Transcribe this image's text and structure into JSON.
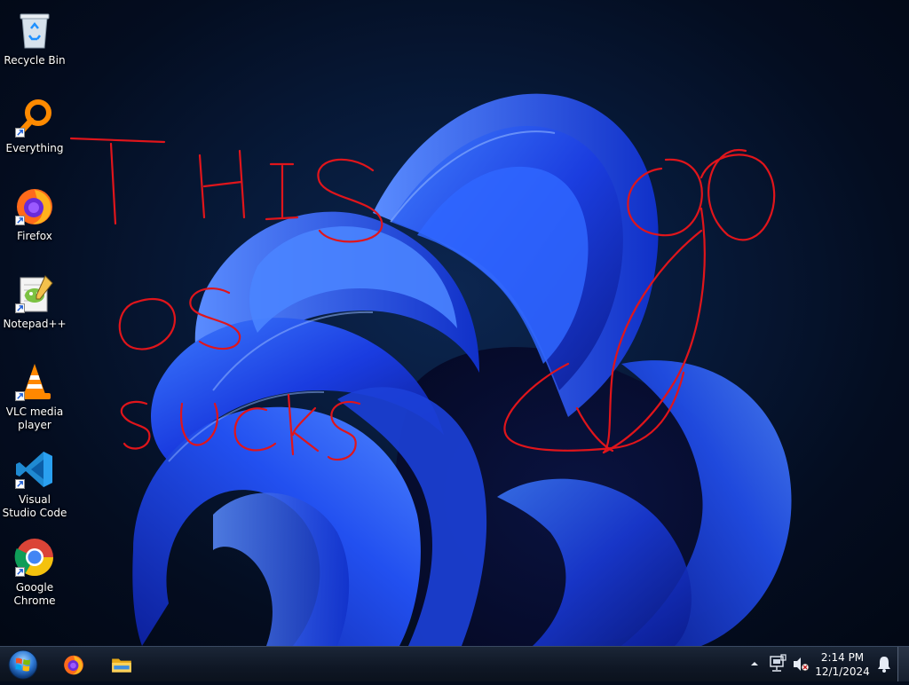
{
  "desktop": {
    "icons": [
      {
        "label": "Recycle Bin",
        "icon": "recycle-bin-icon",
        "shortcut": false
      },
      {
        "label": "Everything",
        "icon": "everything-search-icon",
        "shortcut": true
      },
      {
        "label": "Firefox",
        "icon": "firefox-icon",
        "shortcut": true
      },
      {
        "label": "Notepad++",
        "icon": "notepad-plus-plus-icon",
        "shortcut": true
      },
      {
        "label": "VLC media player",
        "icon": "vlc-cone-icon",
        "shortcut": true
      },
      {
        "label": "Visual Studio Code",
        "icon": "vscode-icon",
        "shortcut": true
      },
      {
        "label": "Google Chrome",
        "icon": "chrome-icon",
        "shortcut": true
      }
    ],
    "wallpaper": "windows-11-bloom-icon",
    "scribble_text": "THIS OS SUCKS",
    "scribble_color": "#e0151b"
  },
  "taskbar": {
    "start": "start-orb-icon",
    "pinned": [
      "firefox-icon",
      "file-explorer-icon"
    ],
    "tray": {
      "overflow": "chevron-up-icon",
      "network": "network-icon",
      "volume": "volume-muted-icon",
      "notifications": "bell-icon"
    },
    "time": "2:14 PM",
    "date": "12/1/2024"
  },
  "colors": {
    "accent": "#1c4bff",
    "taskbar": "#121b2a",
    "scribble": "#e0151b"
  }
}
